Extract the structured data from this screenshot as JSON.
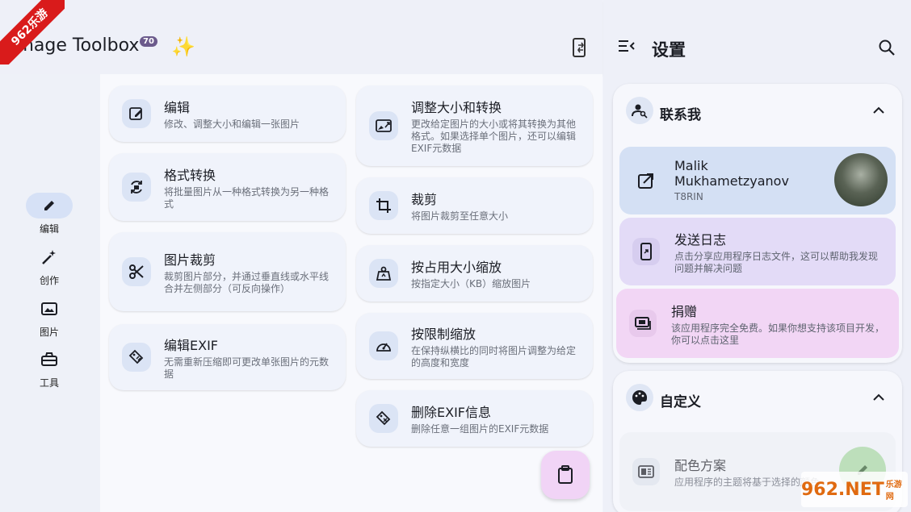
{
  "status": {
    "wifi_icon": "wifi-icon",
    "signal_icon": "signal-icon",
    "battery_icon": "battery-icon"
  },
  "watermark": {
    "corner_label": "962乐游",
    "bottom_label": "962.NET",
    "bottom_sub": "乐游网"
  },
  "app": {
    "title": "Image Toolbox",
    "version_badge": "70",
    "sparkle": "✨"
  },
  "nav": [
    {
      "label": "编辑",
      "icon": "pencil-icon"
    },
    {
      "label": "创作",
      "icon": "magic-wand-icon"
    },
    {
      "label": "图片",
      "icon": "image-icon"
    },
    {
      "label": "工具",
      "icon": "toolbox-icon"
    }
  ],
  "tools_left": [
    {
      "title": "编辑",
      "desc": "修改、调整大小和编辑一张图片",
      "icon": "edit-image-icon"
    },
    {
      "title": "格式转换",
      "desc": "将批量图片从一种格式转换为另一种格式",
      "icon": "convert-icon"
    },
    {
      "title": "图片裁剪",
      "desc": "裁剪图片部分，并通过垂直线或水平线合并左侧部分（可反向操作）",
      "icon": "scissors-icon"
    },
    {
      "title": "编辑EXIF",
      "desc": "无需重新压缩即可更改单张图片的元数据",
      "icon": "tag-edit-icon"
    }
  ],
  "tools_right": [
    {
      "title": "调整大小和转换",
      "desc": "更改给定图片的大小或将其转换为其他格式。如果选择单个图片，还可以编辑EXIF元数据",
      "icon": "resize-image-icon"
    },
    {
      "title": "裁剪",
      "desc": "将图片裁剪至任意大小",
      "icon": "crop-icon"
    },
    {
      "title": "按占用大小缩放",
      "desc": "按指定大小（KB）缩放图片",
      "icon": "weight-icon"
    },
    {
      "title": "按限制缩放",
      "desc": "在保持纵横比的同时将图片调整为给定的高度和宽度",
      "icon": "gauge-icon"
    },
    {
      "title": "删除EXIF信息",
      "desc": "删除任意一组图片的EXIF元数据",
      "icon": "tag-remove-icon"
    }
  ],
  "settings": {
    "title": "设置",
    "contact": {
      "title": "联系我",
      "author_name": "Malik Mukhametzyanov",
      "author_handle": "T8RIN",
      "send_logs_title": "发送日志",
      "send_logs_desc": "点击分享应用程序日志文件，这可以帮助我发现问题并解决问题",
      "donate_title": "捐赠",
      "donate_desc": "该应用程序完全免费。如果你想支持该项目开发，你可以点击这里"
    },
    "customize": {
      "title": "自定义",
      "scheme_title": "配色方案",
      "scheme_desc": "应用程序的主题将基于选择的颜色"
    }
  },
  "colors": {
    "accent": "#3b6bb5",
    "author_card": "#d4e0f4",
    "logs_card": "#e3dbf7",
    "donate_card": "#f2d6f5",
    "fab": "#f1d4f6"
  }
}
